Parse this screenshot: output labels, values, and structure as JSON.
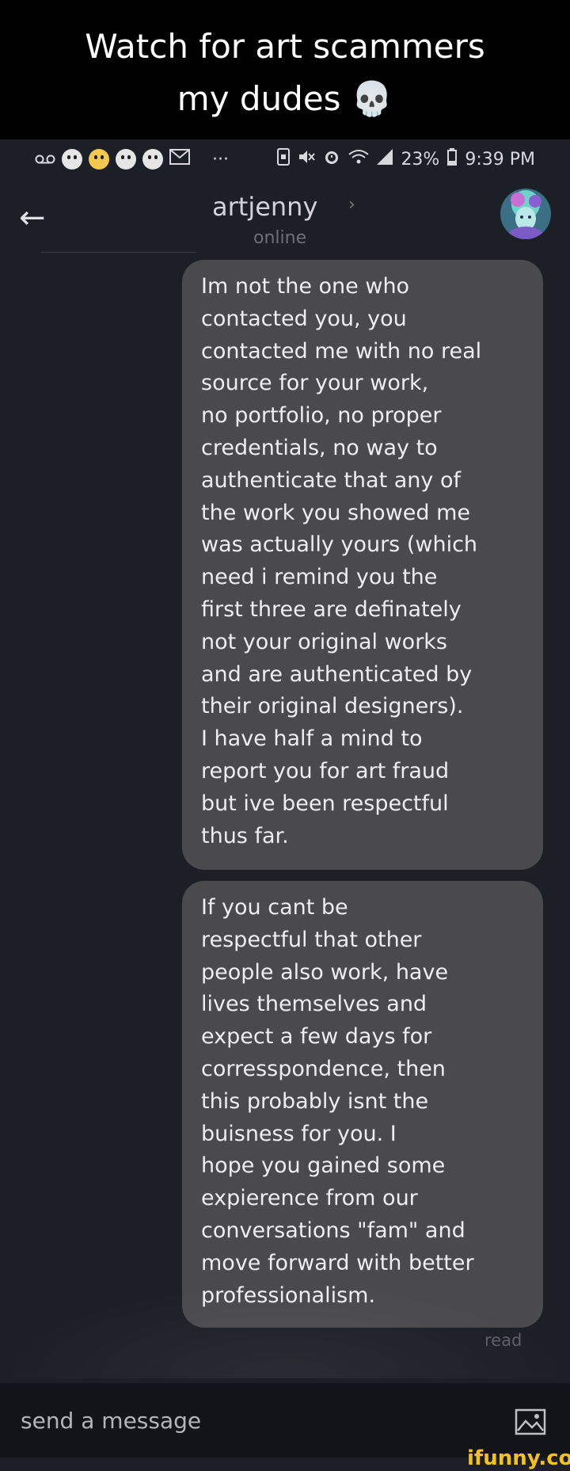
{
  "caption": {
    "line1": "Watch for art scammers",
    "line2": "my dudes",
    "emoji": "💀"
  },
  "statusbar": {
    "dots": "···",
    "battery": "23%",
    "time": "9:39 PM"
  },
  "header": {
    "back": "←",
    "contact": "artjenny",
    "chevron": "›",
    "status": "online"
  },
  "messages": [
    {
      "text": "Im not the one who\ncontacted you, you\ncontacted me with no real\nsource for your work,\nno portfolio, no proper\ncredentials, no way to\nauthenticate that any of\nthe work you showed me\nwas actually yours (which\nneed i remind you the\nfirst three are definately\nnot your original works\nand are authenticated by\ntheir original designers).\nI have half a mind to\nreport you for art fraud\nbut ive been respectful\nthus far."
    },
    {
      "text": "If you cant be\nrespectful that other\npeople also work, have\nlives themselves and\nexpect a few days for\ncorresspondence, then\nthis probably isnt the\nbuisness for you. I\nhope you gained some\nexpierence from our\nconversations \"fam\" and\nmove forward with better\nprofessionalism."
    }
  ],
  "read_receipt": "read",
  "composer": {
    "placeholder": "send a message"
  },
  "watermark": "ifunny.co",
  "colors": {
    "background": "#1d1f26",
    "bubble": "#4a4a4d",
    "composer": "#131419",
    "watermark": "#f4c21e"
  }
}
